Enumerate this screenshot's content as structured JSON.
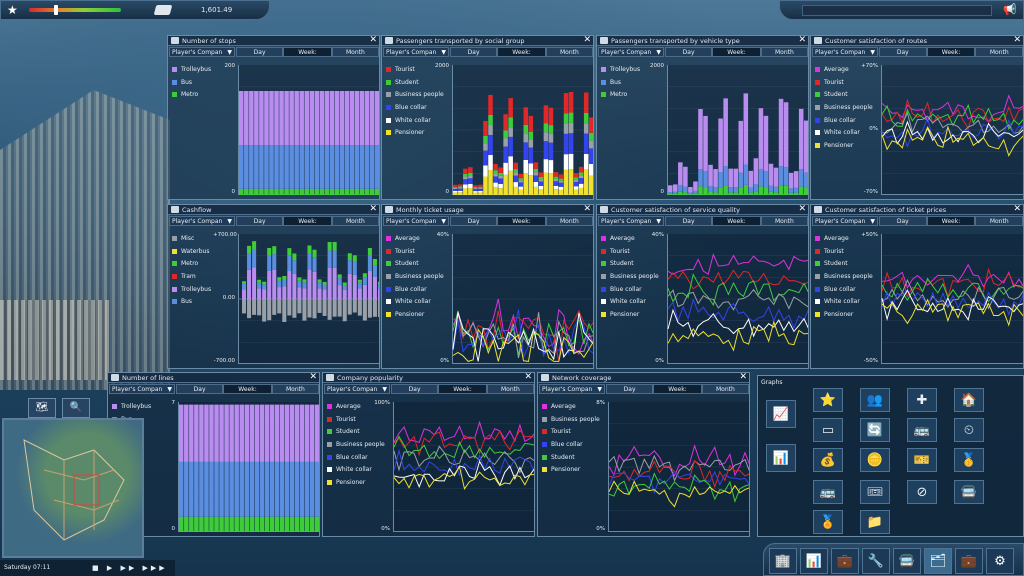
{
  "topbar": {
    "money": "1,601.49",
    "satisfaction": 0.25
  },
  "panels": [
    {
      "id": "stops",
      "title": "Number of stops",
      "company": "Player's Compan",
      "tabs": [
        "Day",
        "Week:",
        "Month"
      ],
      "active": 1,
      "ytop": "200",
      "ybot": "0",
      "legend": [
        {
          "label": "Trolleybus",
          "color": "#b98cf0"
        },
        {
          "label": "Bus",
          "color": "#5b8ee0"
        },
        {
          "label": "Metro",
          "color": "#3fcc3a"
        }
      ]
    },
    {
      "id": "social",
      "title": "Passengers transported by social group",
      "company": "Player's Compan",
      "tabs": [
        "Day",
        "Week:",
        "Month"
      ],
      "active": 1,
      "ytop": "2000",
      "ybot": "0",
      "legend": [
        {
          "label": "Tourist",
          "color": "#e02828"
        },
        {
          "label": "Student",
          "color": "#3fcc3a"
        },
        {
          "label": "Business people",
          "color": "#9aa0a8"
        },
        {
          "label": "Blue collar",
          "color": "#3344ee"
        },
        {
          "label": "White collar",
          "color": "#ffffff"
        },
        {
          "label": "Pensioner",
          "color": "#f0e030"
        }
      ]
    },
    {
      "id": "vehicle",
      "title": "Passengers transported by vehicle type",
      "company": "Player's Compan",
      "tabs": [
        "Day",
        "Week:",
        "Month"
      ],
      "active": 1,
      "ytop": "2000",
      "ybot": "0",
      "legend": [
        {
          "label": "Trolleybus",
          "color": "#b98cf0"
        },
        {
          "label": "Bus",
          "color": "#5b8ee0"
        },
        {
          "label": "Metro",
          "color": "#3fcc3a"
        }
      ]
    },
    {
      "id": "routes",
      "title": "Customer satisfaction of routes",
      "company": "Player's Compan",
      "tabs": [
        "Day",
        "Week:",
        "Month"
      ],
      "active": 1,
      "ytop": "+70%",
      "ymid": "0%",
      "ybot": "-70%",
      "legend": [
        {
          "label": "Average",
          "color": "#e030e0"
        },
        {
          "label": "Tourist",
          "color": "#e02828"
        },
        {
          "label": "Student",
          "color": "#3fcc3a"
        },
        {
          "label": "Business people",
          "color": "#9aa0a8"
        },
        {
          "label": "Blue collar",
          "color": "#3344ee"
        },
        {
          "label": "White collar",
          "color": "#ffffff"
        },
        {
          "label": "Pensioner",
          "color": "#f0e030"
        }
      ]
    },
    {
      "id": "cashflow",
      "title": "Cashflow",
      "company": "Player's Compan",
      "tabs": [
        "Day",
        "Week:",
        "Month"
      ],
      "active": 1,
      "ytop": "+700.00",
      "ymid": "0.00",
      "ybot": "-700.00",
      "legend": [
        {
          "label": "Misc",
          "color": "#9aa0a8"
        },
        {
          "label": "Waterbus",
          "color": "#f0e030"
        },
        {
          "label": "Metro",
          "color": "#3fcc3a"
        },
        {
          "label": "Tram",
          "color": "#e02828"
        },
        {
          "label": "Trolleybus",
          "color": "#b98cf0"
        },
        {
          "label": "Bus",
          "color": "#5b8ee0"
        }
      ]
    },
    {
      "id": "ticket",
      "title": "Monthly ticket usage",
      "company": "Player's Compan",
      "tabs": [
        "Day",
        "Week:",
        "Month"
      ],
      "active": 1,
      "ytop": "40%",
      "ybot": "0%",
      "legend": [
        {
          "label": "Average",
          "color": "#e030e0"
        },
        {
          "label": "Tourist",
          "color": "#e02828"
        },
        {
          "label": "Student",
          "color": "#3fcc3a"
        },
        {
          "label": "Business people",
          "color": "#9aa0a8"
        },
        {
          "label": "Blue collar",
          "color": "#3344ee"
        },
        {
          "label": "White collar",
          "color": "#ffffff"
        },
        {
          "label": "Pensioner",
          "color": "#f0e030"
        }
      ]
    },
    {
      "id": "service",
      "title": "Customer satisfaction of service quality",
      "company": "Player's Compan",
      "tabs": [
        "Day",
        "Week:",
        "Month"
      ],
      "active": 1,
      "ytop": "40%",
      "ybot": "0%",
      "legend": [
        {
          "label": "Average",
          "color": "#e030e0"
        },
        {
          "label": "Tourist",
          "color": "#e02828"
        },
        {
          "label": "Student",
          "color": "#3fcc3a"
        },
        {
          "label": "Business people",
          "color": "#9aa0a8"
        },
        {
          "label": "Blue collar",
          "color": "#3344ee"
        },
        {
          "label": "White collar",
          "color": "#ffffff"
        },
        {
          "label": "Pensioner",
          "color": "#f0e030"
        }
      ]
    },
    {
      "id": "prices",
      "title": "Customer satisfaction of ticket prices",
      "company": "Player's Compan",
      "tabs": [
        "Day",
        "Week:",
        "Month"
      ],
      "active": 1,
      "ytop": "+50%",
      "ybot": "-50%",
      "legend": [
        {
          "label": "Average",
          "color": "#e030e0"
        },
        {
          "label": "Tourist",
          "color": "#e02828"
        },
        {
          "label": "Student",
          "color": "#3fcc3a"
        },
        {
          "label": "Business people",
          "color": "#9aa0a8"
        },
        {
          "label": "Blue collar",
          "color": "#3344ee"
        },
        {
          "label": "White collar",
          "color": "#ffffff"
        },
        {
          "label": "Pensioner",
          "color": "#f0e030"
        }
      ]
    },
    {
      "id": "lines",
      "title": "Number of lines",
      "company": "Player's Compan",
      "tabs": [
        "Day",
        "Week:",
        "Month"
      ],
      "active": 1,
      "ytop": "7",
      "ybot": "0",
      "legend": [
        {
          "label": "Trolleybus",
          "color": "#b98cf0"
        },
        {
          "label": "Bus",
          "color": "#5b8ee0"
        },
        {
          "label": "Metro",
          "color": "#3fcc3a"
        }
      ]
    },
    {
      "id": "popularity",
      "title": "Company popularity",
      "company": "Player's Compan",
      "tabs": [
        "Day",
        "Week:",
        "Month"
      ],
      "active": 1,
      "ytop": "100%",
      "ybot": "0%",
      "legend": [
        {
          "label": "Average",
          "color": "#e030e0"
        },
        {
          "label": "Tourist",
          "color": "#e02828"
        },
        {
          "label": "Student",
          "color": "#3fcc3a"
        },
        {
          "label": "Business people",
          "color": "#9aa0a8"
        },
        {
          "label": "Blue collar",
          "color": "#3344ee"
        },
        {
          "label": "White collar",
          "color": "#ffffff"
        },
        {
          "label": "Pensioner",
          "color": "#f0e030"
        }
      ]
    },
    {
      "id": "coverage",
      "title": "Network coverage",
      "company": "Player's Compan",
      "tabs": [
        "Day",
        "Week:",
        "Month"
      ],
      "active": 1,
      "ytop": "8%",
      "ybot": "0%",
      "legend": [
        {
          "label": "Average",
          "color": "#e030e0"
        },
        {
          "label": "Business people",
          "color": "#9aa0a8"
        },
        {
          "label": "Tourist",
          "color": "#e02828"
        },
        {
          "label": "Blue collar",
          "color": "#3344ee"
        },
        {
          "label": "Student",
          "color": "#3fcc3a"
        },
        {
          "label": "Pensioner",
          "color": "#f0e030"
        }
      ]
    }
  ],
  "graphs": {
    "title": "Graphs"
  },
  "clock": {
    "time": "Saturday 07:11"
  }
}
